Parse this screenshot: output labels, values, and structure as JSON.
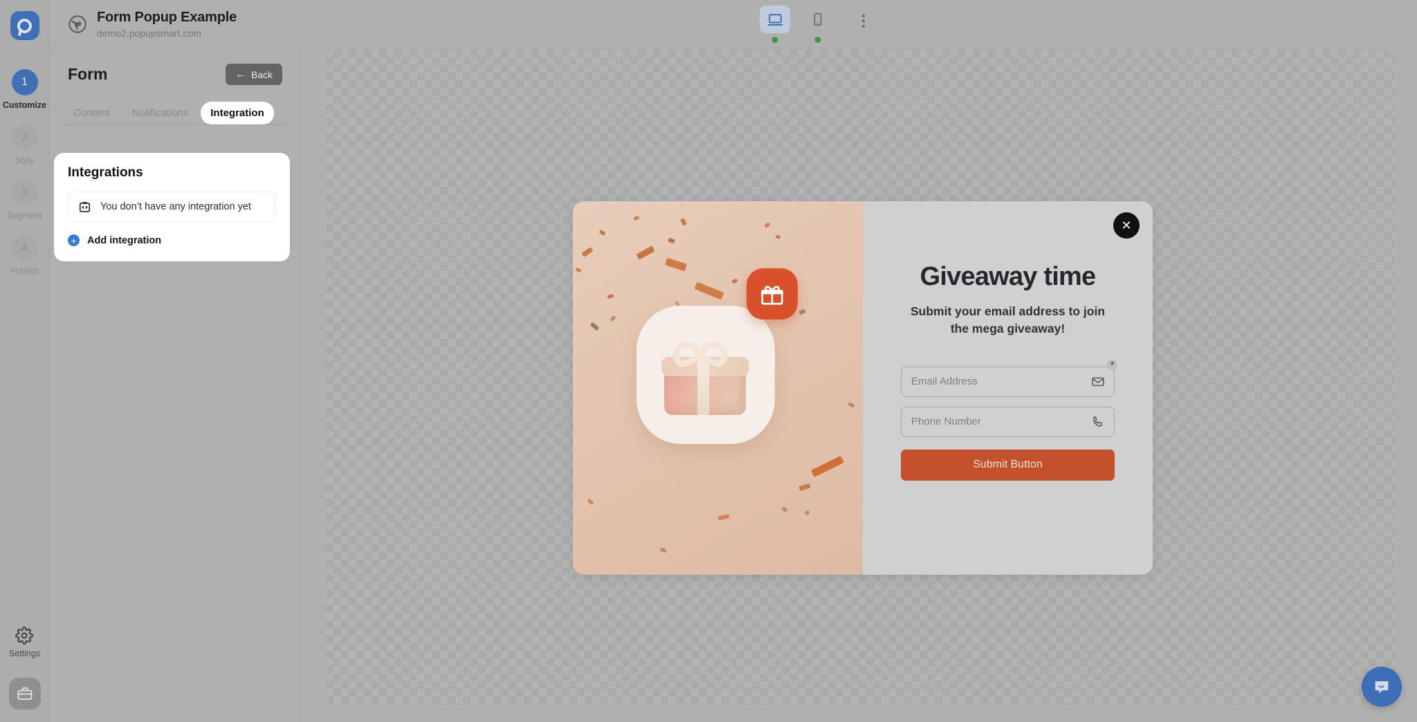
{
  "brand": {
    "logo_icon": "popupsmart-logo-icon"
  },
  "header": {
    "globe_icon": "globe-icon",
    "title": "Form Popup Example",
    "url": "demo2.popupsmart.com",
    "devices": [
      {
        "icon": "desktop-icon",
        "name": "desktop",
        "selected": true,
        "status_dot": "green"
      },
      {
        "icon": "mobile-icon",
        "name": "mobile",
        "selected": false,
        "status_dot": "green"
      }
    ],
    "more_menu_icon": "kebab-menu-icon"
  },
  "sidebar": {
    "steps": [
      {
        "number": "1",
        "label": "Customize",
        "active": true
      },
      {
        "number": "2",
        "label": "Style",
        "active": false
      },
      {
        "number": "3",
        "label": "Segment",
        "active": false
      },
      {
        "number": "4",
        "label": "Publish",
        "active": false
      }
    ],
    "settings": {
      "icon": "gear-icon",
      "label": "Settings"
    },
    "workspace": {
      "icon": "briefcase-icon"
    }
  },
  "panel": {
    "title": "Form",
    "back_label": "Back",
    "back_icon": "arrow-left-icon",
    "tabs": [
      {
        "label": "Content",
        "active": false
      },
      {
        "label": "Notifications",
        "active": false
      },
      {
        "label": "Integration",
        "active": true
      }
    ],
    "card": {
      "title": "Integrations",
      "empty_icon": "code-clipboard-icon",
      "empty_text": "You don’t have any integration yet",
      "add_icon": "plus-circle-icon",
      "add_label": "Add integration"
    }
  },
  "popup": {
    "close_icon": "close-icon",
    "title": "Giveaway time",
    "subtitle": "Submit your email address to join the mega giveaway!",
    "gift_badge_icon": "gift-icon",
    "fields": [
      {
        "name": "email",
        "placeholder": "Email Address",
        "value": "",
        "icon": "envelope-icon",
        "required": true,
        "required_marker": "*"
      },
      {
        "name": "phone",
        "placeholder": "Phone Number",
        "value": "",
        "icon": "phone-icon",
        "required": false
      }
    ],
    "submit_label": "Submit Button",
    "colors": {
      "accent": "#c4512c",
      "badge": "#d9512a",
      "panel_bg": "#d0d0d0"
    }
  },
  "chat": {
    "icon": "chat-bubble-icon"
  }
}
